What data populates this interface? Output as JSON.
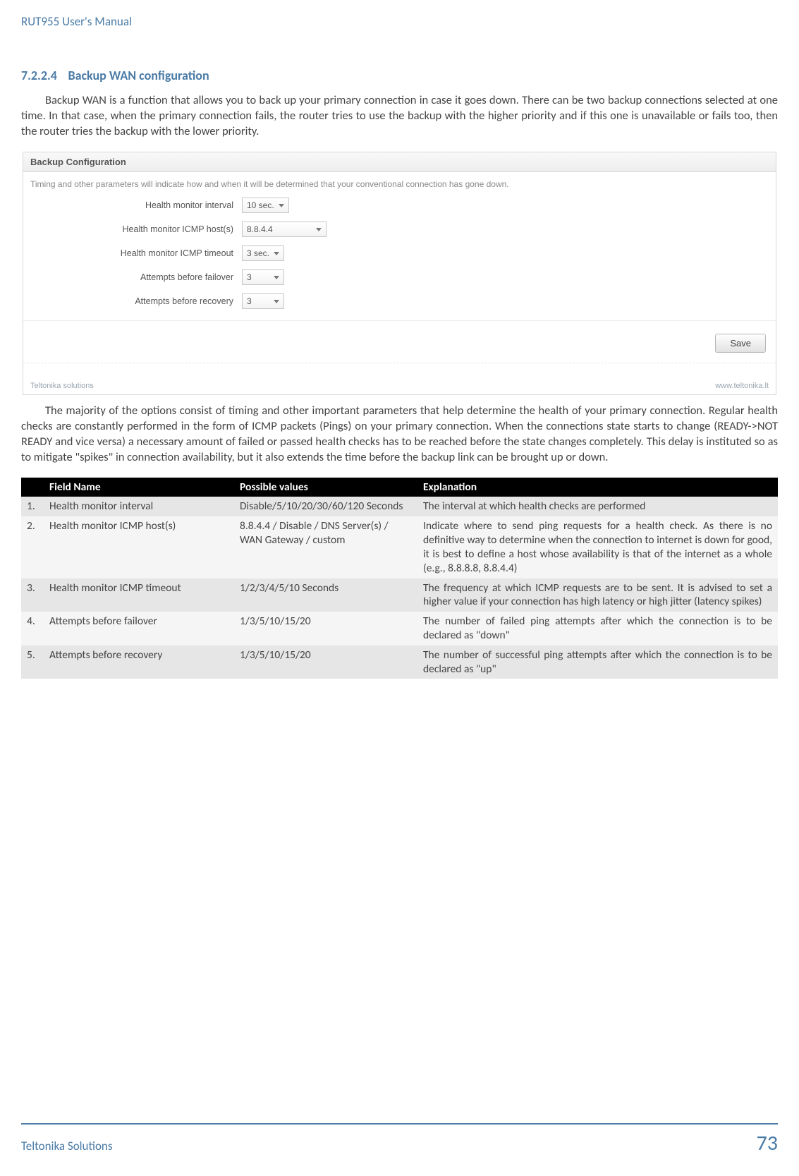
{
  "doc_header": "RUT955 User's Manual",
  "section": {
    "number": "7.2.2.4",
    "title": "Backup WAN configuration"
  },
  "para1": "Backup WAN is a function that allows you to back up your primary connection in case it goes down. There can be two backup connections selected at one time. In that case, when the primary connection fails, the router tries to use the backup with the higher priority and if this one is unavailable or fails too, then the router tries the backup with the lower priority.",
  "screenshot": {
    "panel_title": "Backup Configuration",
    "hint": "Timing and other parameters will indicate how and when it will be determined that your conventional connection has gone down.",
    "rows": [
      {
        "label": "Health monitor interval",
        "value": "10 sec.",
        "wide": false
      },
      {
        "label": "Health monitor ICMP host(s)",
        "value": "8.8.4.4",
        "wide": true
      },
      {
        "label": "Health monitor ICMP timeout",
        "value": "3 sec.",
        "wide": false
      },
      {
        "label": "Attempts before failover",
        "value": "3",
        "wide": false
      },
      {
        "label": "Attempts before recovery",
        "value": "3",
        "wide": false
      }
    ],
    "save": "Save",
    "footer_left": "Teltonika solutions",
    "footer_right": "www.teltonika.lt"
  },
  "para2": "The majority of the options consist of timing and other important parameters that help determine the health of your primary connection. Regular health checks are constantly performed in the form of ICMP packets (Pings) on your primary connection. When the connections state starts to change (READY->NOT READY and vice versa) a necessary amount of failed or passed health checks has to be reached before the state changes completely. This delay is instituted so as to mitigate \"spikes\" in connection availability, but it also extends the time before the backup link can be brought up or down.",
  "table": {
    "headers": {
      "num": "",
      "field": "Field Name",
      "vals": "Possible values",
      "expl": "Explanation"
    },
    "rows": [
      {
        "n": "1.",
        "field": "Health monitor interval",
        "vals": "Disable/5/10/20/30/60/120 Seconds",
        "expl": "The interval at which health checks are performed"
      },
      {
        "n": "2.",
        "field": "Health monitor ICMP host(s)",
        "vals": "8.8.4.4 / Disable / DNS Server(s) / WAN Gateway / custom",
        "expl": "Indicate where to send ping requests for a health check. As there is no definitive way to determine when the connection to internet is down for good, it is best to define a host whose availability is that of the internet as a whole (e.g., 8.8.8.8, 8.8.4.4)"
      },
      {
        "n": "3.",
        "field": "Health monitor ICMP timeout",
        "vals": "1/2/3/4/5/10 Seconds",
        "expl": "The frequency at which ICMP requests are to be sent. It is advised to set a higher value if your connection has high latency or high jitter (latency spikes)"
      },
      {
        "n": "4.",
        "field": "Attempts before failover",
        "vals": "1/3/5/10/15/20",
        "expl": "The number of failed ping attempts after which the connection is to be declared as \"down\""
      },
      {
        "n": "5.",
        "field": "Attempts before recovery",
        "vals": "1/3/5/10/15/20",
        "expl": "The number of successful ping attempts after which the connection is to be declared as \"up\""
      }
    ]
  },
  "footer": {
    "brand": "Teltonika Solutions",
    "page": "73"
  }
}
